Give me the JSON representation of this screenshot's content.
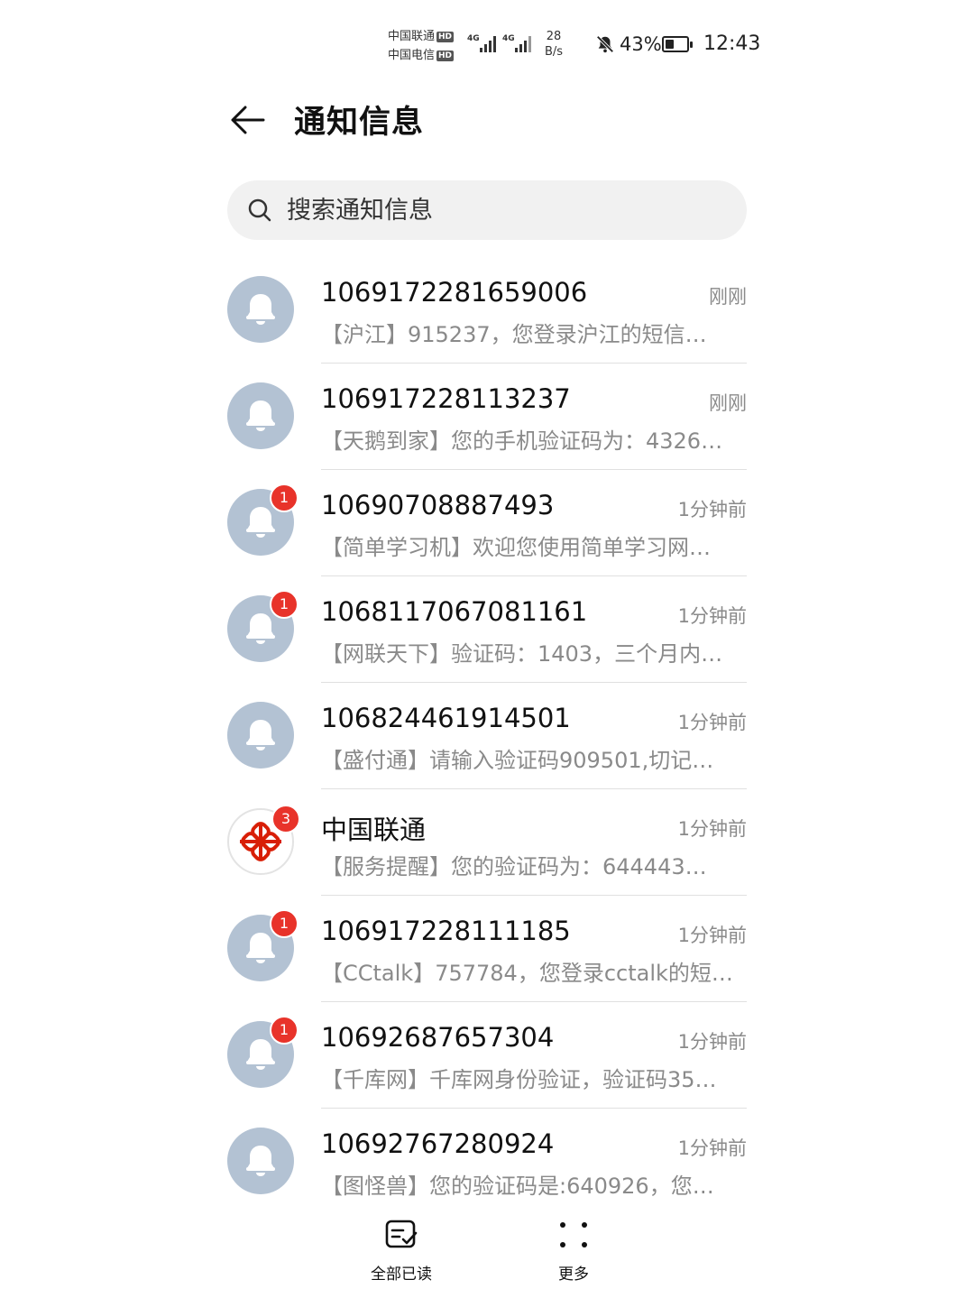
{
  "status_bar": {
    "carrier1": "中国联通",
    "carrier2": "中国电信",
    "hd_label": "HD",
    "net_type": "4G",
    "net_speed_value": "28",
    "net_speed_unit": "B/s",
    "battery_percent": "43%",
    "battery_level": 0.43,
    "time": "12:43"
  },
  "header": {
    "title": "通知信息"
  },
  "search": {
    "placeholder": "搜索通知信息"
  },
  "messages": [
    {
      "sender": "1069172281659006",
      "time": "刚刚",
      "preview": "【沪江】915237，您登录沪江的短信…",
      "badge": "",
      "avatar": "bell-icon"
    },
    {
      "sender": "106917228113237",
      "time": "刚刚",
      "preview": "【天鹅到家】您的手机验证码为：4326…",
      "badge": "",
      "avatar": "bell-icon"
    },
    {
      "sender": "10690708887493",
      "time": "1分钟前",
      "preview": "【简单学习机】欢迎您使用简单学习网…",
      "badge": "1",
      "avatar": "bell-icon"
    },
    {
      "sender": "1068117067081161",
      "time": "1分钟前",
      "preview": "【网联天下】验证码：1403，三个月内…",
      "badge": "1",
      "avatar": "bell-icon"
    },
    {
      "sender": "106824461914501",
      "time": "1分钟前",
      "preview": "【盛付通】请输入验证码909501,切记…",
      "badge": "",
      "avatar": "bell-icon"
    },
    {
      "sender": "中国联通",
      "time": "1分钟前",
      "preview": "【服务提醒】您的验证码为：644443…",
      "badge": "3",
      "avatar": "china-unicom-logo"
    },
    {
      "sender": "106917228111185",
      "time": "1分钟前",
      "preview": "【CCtalk】757784，您登录cctalk的短…",
      "badge": "1",
      "avatar": "bell-icon"
    },
    {
      "sender": "10692687657304",
      "time": "1分钟前",
      "preview": "【千库网】千库网身份验证，验证码35…",
      "badge": "1",
      "avatar": "bell-icon"
    },
    {
      "sender": "10692767280924",
      "time": "1分钟前",
      "preview": "【图怪兽】您的验证码是:640926，您…",
      "badge": "",
      "avatar": "bell-icon"
    }
  ],
  "bottom_actions": {
    "mark_all_read": "全部已读",
    "more": "更多"
  },
  "colors": {
    "avatar_bg": "#b3c2d3",
    "badge": "#e8332a",
    "unicom_red": "#d81e06",
    "secondary_text": "#8a8a8a"
  }
}
